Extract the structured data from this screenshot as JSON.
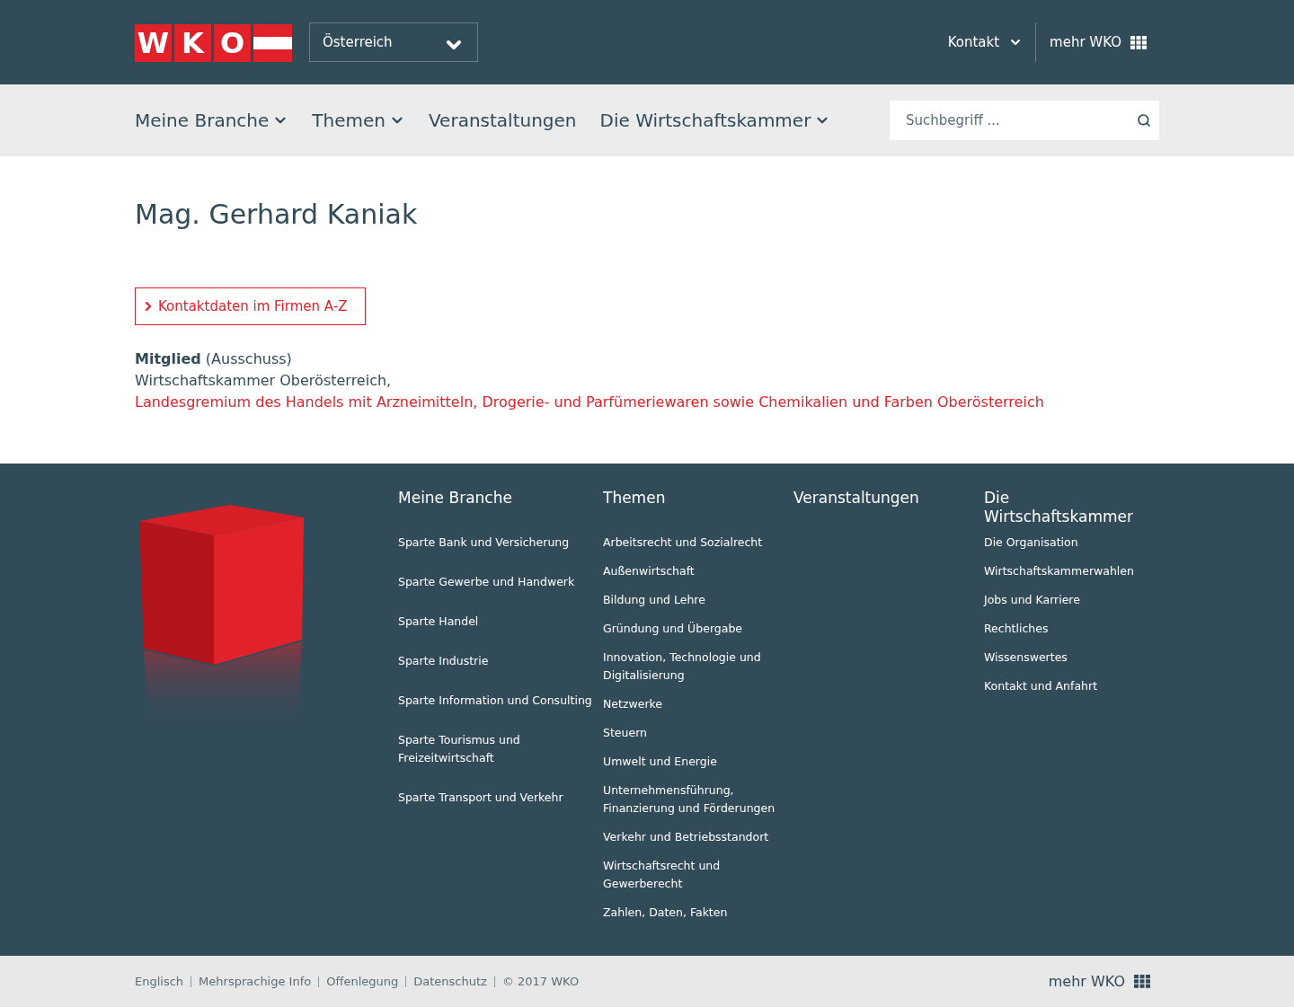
{
  "header": {
    "logo_letters": [
      "W",
      "K",
      "O"
    ],
    "region_select": {
      "value": "Österreich"
    },
    "links": [
      {
        "label": "Kontakt",
        "kind": "dropdown"
      },
      {
        "label": "mehr WKO",
        "kind": "grid"
      }
    ]
  },
  "nav": {
    "items": [
      {
        "label": "Meine Branche",
        "has_menu": true
      },
      {
        "label": "Themen",
        "has_menu": true
      },
      {
        "label": "Veranstaltungen",
        "has_menu": false
      },
      {
        "label": "Die Wirtschaftskammer",
        "has_menu": true
      }
    ],
    "search": {
      "placeholder": "Suchbegriff ..."
    }
  },
  "main": {
    "title": "Mag. Gerhard Kaniak",
    "contact_button": "Kontaktdaten im Firmen A-Z",
    "role": "**Mitglied** (Ausschuss)",
    "org_text": "Wirtschaftskammer Oberösterreich,",
    "org_link": "Landesgremium des Handels mit Arzneimitteln, Drogerie- und Parfümeriewaren sowie Chemikalien und Farben Oberösterreich"
  },
  "footer": {
    "columns": [
      {
        "title": "Meine Branche",
        "links": [
          "Sparte Bank und Versicherung",
          "Sparte Gewerbe und Handwerk",
          "Sparte Handel",
          "Sparte Industrie",
          "Sparte Information und Consulting",
          "Sparte Tourismus und Freizeitwirtschaft",
          "Sparte Transport und Verkehr"
        ]
      },
      {
        "title": "Themen",
        "links": [
          "Arbeitsrecht und Sozialrecht",
          "Außenwirtschaft",
          "Bildung und Lehre",
          "Gründung und Übergabe",
          "Innovation, Technologie und Digitalisierung",
          "Netzwerke",
          "Steuern",
          "Umwelt und Energie",
          "Unternehmensführung, Finanzierung und Förderungen",
          "Verkehr und Betriebsstandort",
          "Wirtschaftsrecht und Gewerberecht",
          "Zahlen, Daten, Fakten"
        ]
      },
      {
        "title": "Veranstaltungen"
      },
      {
        "title": "Die Wirtschaftskammer",
        "links": [
          "Die Organisation",
          "Wirtschaftskammerwahlen",
          "Jobs und Karriere",
          "Rechtliches",
          "Wissenswertes",
          "Kontakt und Anfahrt"
        ]
      }
    ]
  },
  "bottom_bar": {
    "links": [
      "Englisch",
      "Mehrsprachige Info",
      "Offenlegung",
      "Datenschutz"
    ],
    "copyright": "© 2017 WKO",
    "more": "mehr WKO"
  }
}
